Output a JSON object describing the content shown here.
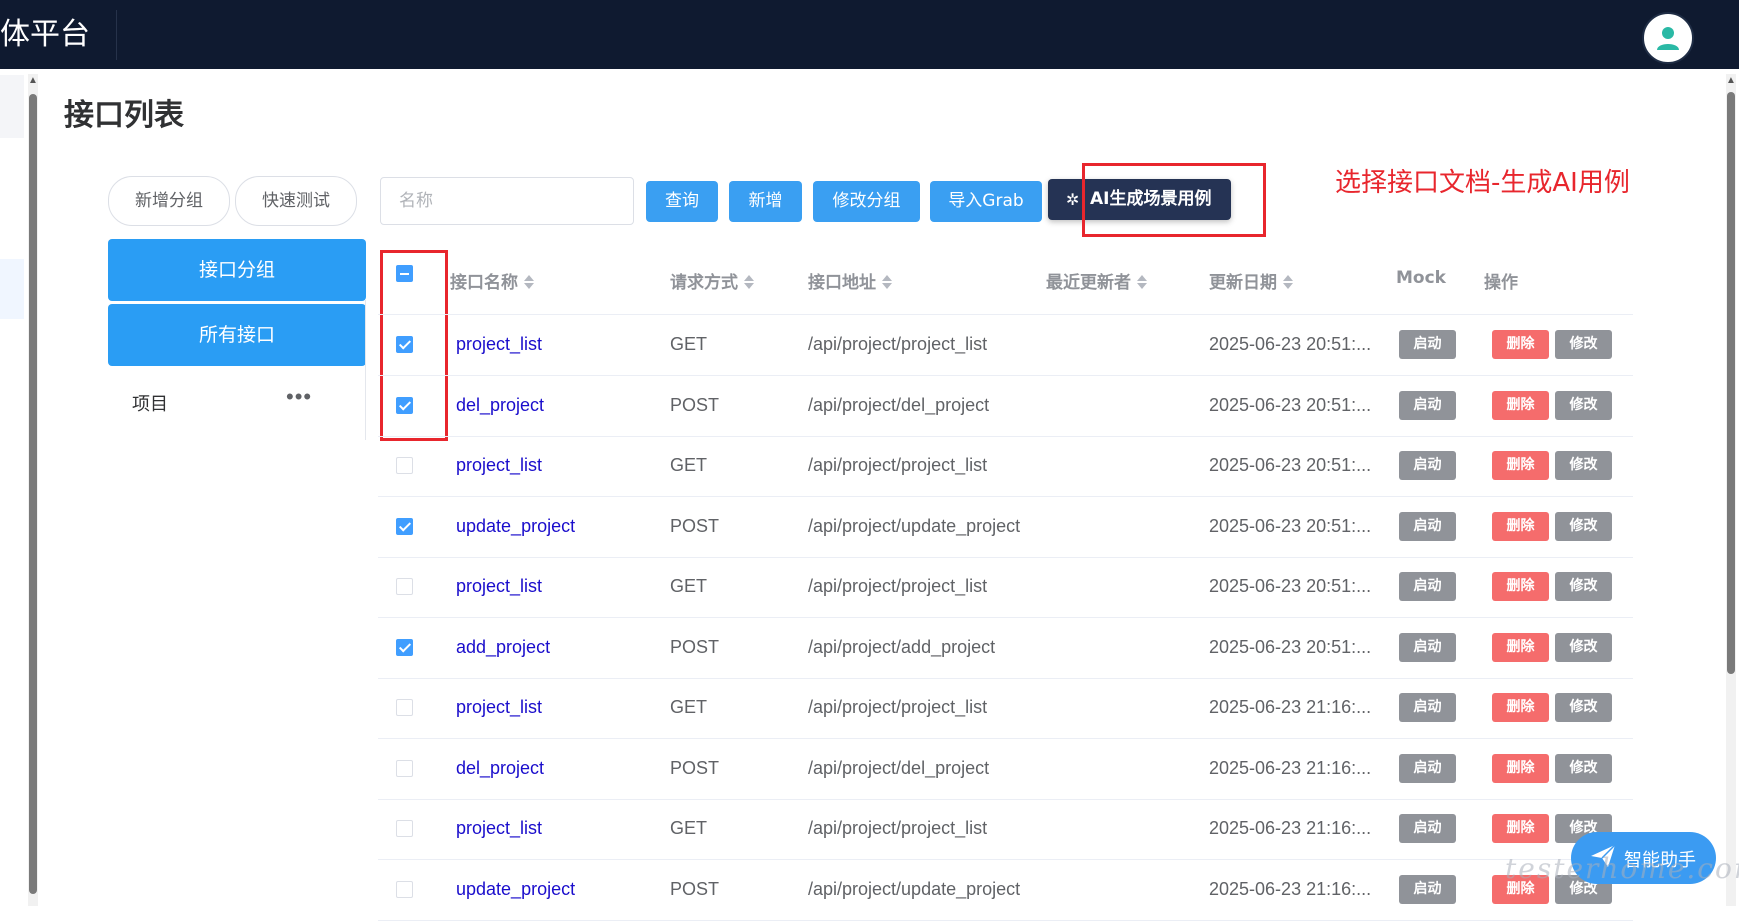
{
  "header": {
    "brand": "体平台"
  },
  "page": {
    "title": "接口列表"
  },
  "left_panel": {
    "add_group_label": "新增分组",
    "quick_test_label": "快速测试",
    "group_label": "接口分组",
    "all_label": "所有接口",
    "tree_item": {
      "label": "项目",
      "more": "•••"
    }
  },
  "toolbar": {
    "search_placeholder": "名称",
    "query_label": "查询",
    "add_label": "新增",
    "edit_group_label": "修改分组",
    "import_label": "导入Grab",
    "ai_label": "AI生成场景用例",
    "ai_icon": "sparkle-icon"
  },
  "annotation": "选择接口文档-生成AI用例",
  "table": {
    "headers": {
      "name": "接口名称",
      "method": "请求方式",
      "path": "接口地址",
      "updater": "最近更新者",
      "date": "更新日期",
      "mock": "Mock",
      "ops": "操作"
    },
    "header_checkbox": "indeterminate",
    "rows": [
      {
        "checked": true,
        "name": "project_list",
        "method": "GET",
        "path": "/api/project/project_list",
        "updater": "",
        "date": "2025-06-23 20:51:...",
        "mock": "启动",
        "delete": "删除",
        "edit": "修改"
      },
      {
        "checked": true,
        "name": "del_project",
        "method": "POST",
        "path": "/api/project/del_project",
        "updater": "",
        "date": "2025-06-23 20:51:...",
        "mock": "启动",
        "delete": "删除",
        "edit": "修改"
      },
      {
        "checked": false,
        "name": "project_list",
        "method": "GET",
        "path": "/api/project/project_list",
        "updater": "",
        "date": "2025-06-23 20:51:...",
        "mock": "启动",
        "delete": "删除",
        "edit": "修改"
      },
      {
        "checked": true,
        "name": "update_project",
        "method": "POST",
        "path": "/api/project/update_project",
        "updater": "",
        "date": "2025-06-23 20:51:...",
        "mock": "启动",
        "delete": "删除",
        "edit": "修改"
      },
      {
        "checked": false,
        "name": "project_list",
        "method": "GET",
        "path": "/api/project/project_list",
        "updater": "",
        "date": "2025-06-23 20:51:...",
        "mock": "启动",
        "delete": "删除",
        "edit": "修改"
      },
      {
        "checked": true,
        "name": "add_project",
        "method": "POST",
        "path": "/api/project/add_project",
        "updater": "",
        "date": "2025-06-23 20:51:...",
        "mock": "启动",
        "delete": "删除",
        "edit": "修改"
      },
      {
        "checked": false,
        "name": "project_list",
        "method": "GET",
        "path": "/api/project/project_list",
        "updater": "",
        "date": "2025-06-23 21:16:...",
        "mock": "启动",
        "delete": "删除",
        "edit": "修改"
      },
      {
        "checked": false,
        "name": "del_project",
        "method": "POST",
        "path": "/api/project/del_project",
        "updater": "",
        "date": "2025-06-23 21:16:...",
        "mock": "启动",
        "delete": "删除",
        "edit": "修改"
      },
      {
        "checked": false,
        "name": "project_list",
        "method": "GET",
        "path": "/api/project/project_list",
        "updater": "",
        "date": "2025-06-23 21:16:...",
        "mock": "启动",
        "delete": "删除",
        "edit": "修改"
      },
      {
        "checked": false,
        "name": "update_project",
        "method": "POST",
        "path": "/api/project/update_project",
        "updater": "",
        "date": "2025-06-23 21:16:...",
        "mock": "启动",
        "delete": "删除",
        "edit": "修改"
      }
    ]
  },
  "assistant": {
    "label": "智能助手",
    "icon": "paper-plane-icon"
  },
  "watermark": "testerhome.com",
  "colors": {
    "primary": "#409eff",
    "header_bg": "#0f1a30",
    "ai_button": "#253354",
    "danger": "#f56c6c",
    "annotation": "#e8262d"
  }
}
